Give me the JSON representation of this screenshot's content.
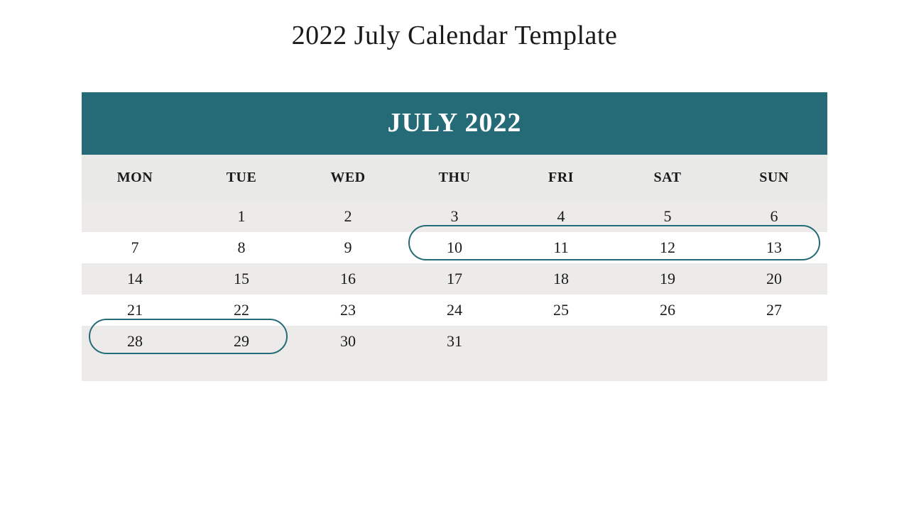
{
  "title": "2022 July Calendar Template",
  "month_header": "JULY 2022",
  "colors": {
    "accent": "#256a77",
    "row_alt": "#ecebe9",
    "header_row": "#e9e9e7"
  },
  "weekdays": [
    "MON",
    "TUE",
    "WED",
    "THU",
    "FRI",
    "SAT",
    "SUN"
  ],
  "weeks": [
    [
      "",
      "1",
      "2",
      "3",
      "4",
      "5",
      "6"
    ],
    [
      "7",
      "8",
      "9",
      "10",
      "11",
      "12",
      "13"
    ],
    [
      "14",
      "15",
      "16",
      "17",
      "18",
      "19",
      "20"
    ],
    [
      "21",
      "22",
      "23",
      "24",
      "25",
      "26",
      "27"
    ],
    [
      "28",
      "29",
      "30",
      "31",
      "",
      "",
      ""
    ]
  ],
  "highlights": [
    {
      "row": 1,
      "col_start": 3,
      "col_end": 6
    },
    {
      "row": 4,
      "col_start": 0,
      "col_end": 1
    }
  ]
}
